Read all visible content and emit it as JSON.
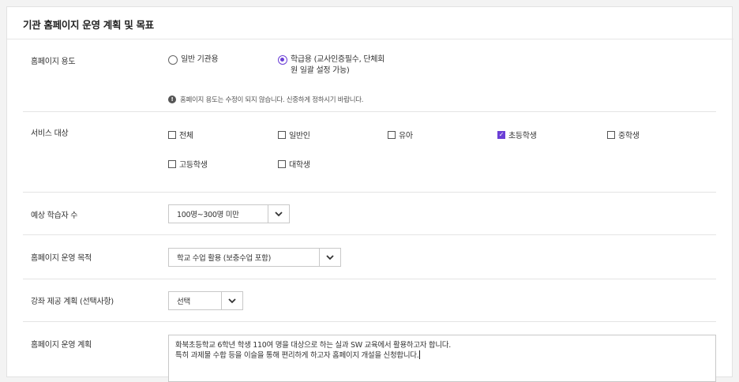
{
  "section_title": "기관 홈페이지 운영 계획 및 목표",
  "usage": {
    "label": "홈페이지 용도",
    "options": [
      {
        "label": "일반 기관용",
        "selected": false
      },
      {
        "label_line1": "학급용 (교사인증필수, 단체회",
        "label_line2": "원 일괄 설정 가능)",
        "selected": true
      }
    ],
    "note": "홈페이지 용도는 수정이 되지 않습니다. 신중하게 정하시기 바랍니다.",
    "note_icon": "info-icon"
  },
  "target": {
    "label": "서비스 대상",
    "options": [
      {
        "label": "전체",
        "checked": false
      },
      {
        "label": "일반인",
        "checked": false
      },
      {
        "label": "유아",
        "checked": false
      },
      {
        "label": "초등학생",
        "checked": true
      },
      {
        "label": "중학생",
        "checked": false
      },
      {
        "label": "고등학생",
        "checked": false
      },
      {
        "label": "대학생",
        "checked": false
      }
    ]
  },
  "learners": {
    "label": "예상 학습자 수",
    "value": "100명~300명 미만"
  },
  "purpose": {
    "label": "홈페이지 운영 목적",
    "value": "학교 수업 활용 (보충수업 포함)"
  },
  "course_plan": {
    "label": "강좌 제공 계획 (선택사항)",
    "value": "선택"
  },
  "operation_plan": {
    "label": "홈페이지 운영 계획",
    "line1": "화북초등학교 6학년 학생 110여 명을 대상으로 하는 실과 SW 교육에서 활용하고자 합니다.",
    "line2": "특히 과제물 수합 등을 이슬을 통해 편리하게 하고자 홈페이지 개설을 신청합니다."
  },
  "colors": {
    "accent": "#6b3fd6",
    "border": "#c8c8c8",
    "background": "#f3f3f3"
  }
}
